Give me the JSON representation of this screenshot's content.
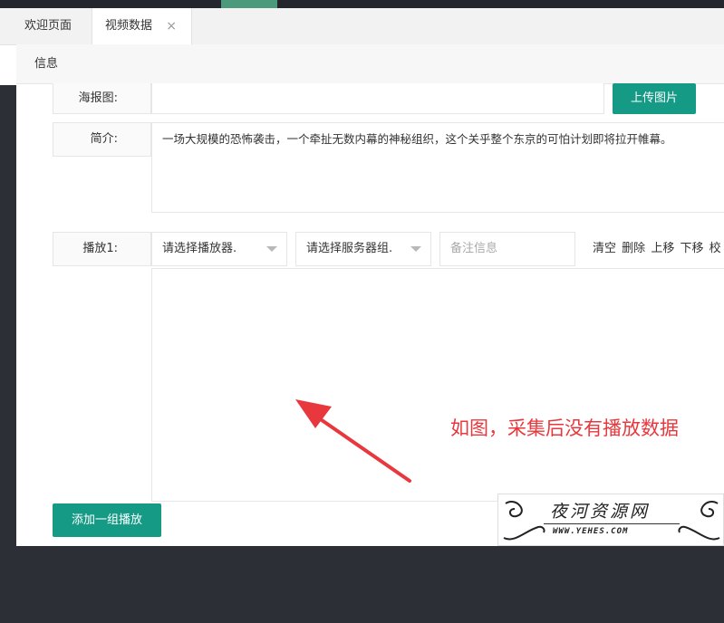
{
  "tabs": {
    "welcome": "欢迎页面",
    "video_data": "视频数据",
    "close_glyph": "×"
  },
  "subnav": {
    "info": "信息"
  },
  "form": {
    "poster_label": "海报图:",
    "poster_value": "",
    "upload_button": "上传图片",
    "intro_label": "简介:",
    "intro_text": "一场大规模的恐怖袭击，一个牵扯无数内幕的神秘组织，这个关乎整个东京的可怕计划即将拉开帷幕。",
    "play_label": "播放1:",
    "player_select": "请选择播放器.",
    "server_select": "请选择服务器组.",
    "note_placeholder": "备注信息",
    "actions": [
      "清空",
      "删除",
      "上移",
      "下移",
      "校"
    ],
    "play_urls": "",
    "add_group_button": "添加一组播放"
  },
  "annotation": {
    "text": "如图，采集后没有播放数据",
    "color": "#e8383d"
  },
  "watermark": {
    "title": "夜河资源网",
    "url": "WWW.YEHES.COM"
  },
  "colors": {
    "accent": "#159a86",
    "topbar": "#24262d"
  }
}
